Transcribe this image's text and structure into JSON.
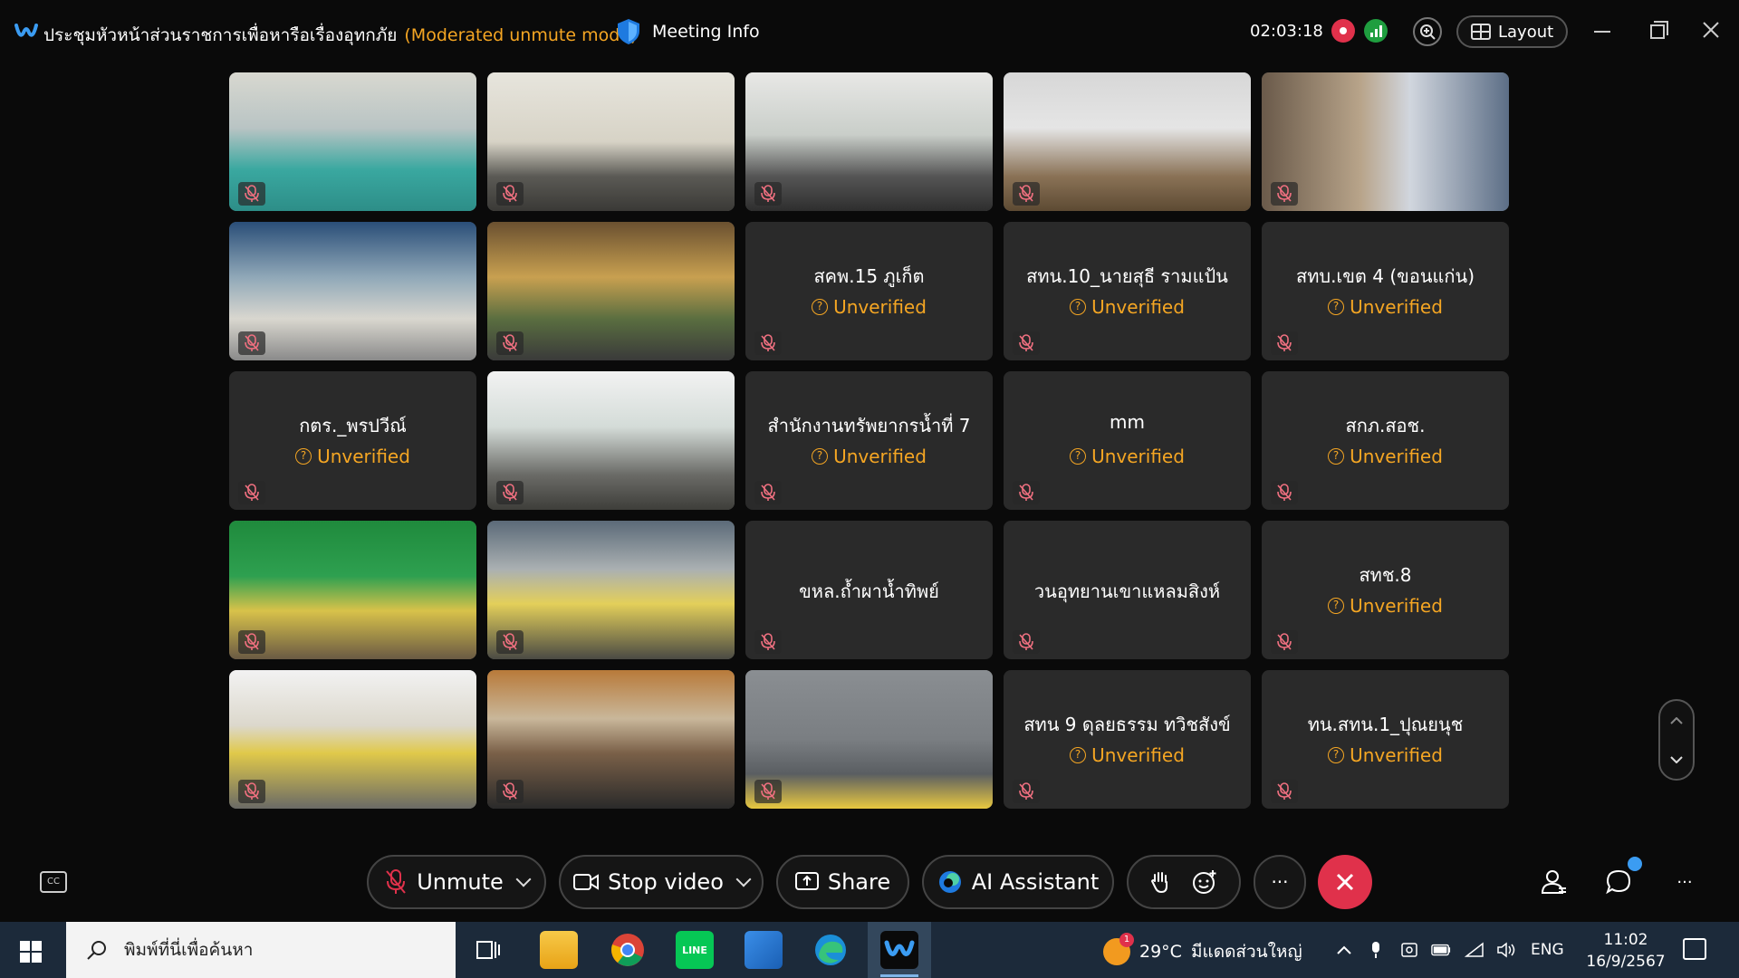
{
  "window": {
    "title": "ประชุมหัวหน้าส่วนราชการเพื่อหารือเรื่องอุทกภัย",
    "mode": "(Moderated unmute mode)",
    "meeting_info_label": "Meeting Info",
    "timer": "02:03:18",
    "layout_label": "Layout"
  },
  "colors": {
    "accent_orange": "#f5a623",
    "recording_red": "#e0314b",
    "signal_green": "#1f9e3f",
    "tile_bg": "#2a2a2a"
  },
  "tiles": [
    {
      "type": "video",
      "scene": "teal",
      "muted": true
    },
    {
      "type": "video",
      "scene": "office",
      "muted": true
    },
    {
      "type": "video",
      "scene": "conf",
      "muted": true
    },
    {
      "type": "video",
      "scene": "desk",
      "muted": true
    },
    {
      "type": "video",
      "scene": "room",
      "muted": true
    },
    {
      "type": "video",
      "scene": "blue",
      "muted": true
    },
    {
      "type": "video",
      "scene": "gold",
      "muted": true
    },
    {
      "type": "name",
      "name": "สคพ.15 ภูเก็ต",
      "unverified": "Unverified",
      "muted": true
    },
    {
      "type": "name",
      "name": "สทน.10_นายสุธี รามแป้น",
      "unverified": "Unverified",
      "muted": true
    },
    {
      "type": "name",
      "name": "สทบ.เขต 4 (ขอนแก่น)",
      "unverified": "Unverified",
      "muted": true
    },
    {
      "type": "name",
      "name": "กตร._พรปวีณ์",
      "unverified": "Unverified",
      "muted": true
    },
    {
      "type": "video",
      "scene": "white",
      "muted": true
    },
    {
      "type": "name",
      "name": "สำนักงานทรัพยากรน้ำที่ 7",
      "unverified": "Unverified",
      "muted": true
    },
    {
      "type": "name",
      "name": "mm",
      "unverified": "Unverified",
      "muted": true
    },
    {
      "type": "name",
      "name": "สกภ.สอช.",
      "unverified": "Unverified",
      "muted": true
    },
    {
      "type": "video",
      "scene": "green",
      "muted": true
    },
    {
      "type": "video",
      "scene": "people",
      "muted": true
    },
    {
      "type": "name",
      "name": "ขหล.ถ้ำผาน้ำทิพย์",
      "unverified": "",
      "muted": true
    },
    {
      "type": "name",
      "name": "วนอุทยานเขาแหลมสิงห์",
      "unverified": "",
      "muted": true
    },
    {
      "type": "name",
      "name": "สทช.8",
      "unverified": "Unverified",
      "muted": true
    },
    {
      "type": "video",
      "scene": "meet",
      "muted": true
    },
    {
      "type": "video",
      "scene": "man",
      "muted": true
    },
    {
      "type": "video",
      "scene": "gray",
      "muted": true
    },
    {
      "type": "name",
      "name": "สทน 9 ดุลยธรรม ทวิชสังข์",
      "unverified": "Unverified",
      "muted": true
    },
    {
      "type": "name",
      "name": "ทน.สทน.1_ปุณยนุช",
      "unverified": "Unverified",
      "muted": true
    }
  ],
  "controls": {
    "cc_label": "CC",
    "unmute_label": "Unmute",
    "stop_video_label": "Stop video",
    "share_label": "Share",
    "ai_assistant_label": "AI Assistant",
    "more_label": "···"
  },
  "taskbar": {
    "search_placeholder": "พิมพ์ที่นี่เพื่อค้นหา",
    "line_label": "LINE",
    "weather_temp": "29°C",
    "weather_desc": "มีแดดส่วนใหญ่",
    "weather_badge": "1",
    "language": "ENG",
    "time": "11:02",
    "date": "16/9/2567"
  }
}
